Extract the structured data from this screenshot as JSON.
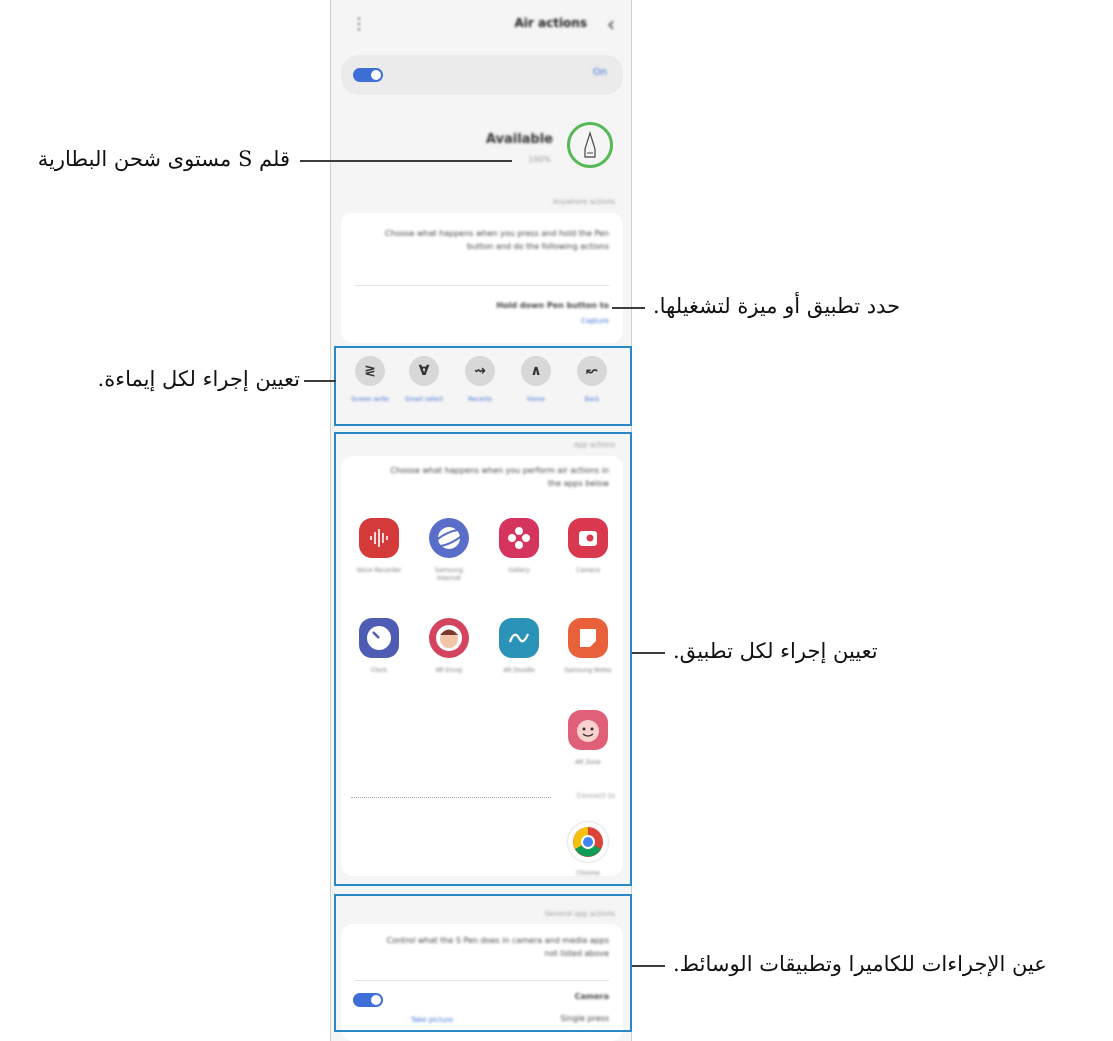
{
  "phone": {
    "title": "Air actions",
    "back_icon": "‹",
    "menu_icon": "⋮",
    "on_label": "On",
    "status_title": "Available",
    "battery_text": "100%",
    "anywhere_header": "Anywhere actions",
    "anywhere_desc": "Choose what happens when you press and hold the Pen button and do the following actions",
    "hold_title": "Hold down Pen button to",
    "hold_value": "Capture",
    "gestures": [
      {
        "glyph": "↜",
        "label": "Back"
      },
      {
        "glyph": "∧",
        "label": "Home"
      },
      {
        "glyph": "⇝",
        "label": "Recents"
      },
      {
        "glyph": "∀",
        "label": "Smart select"
      },
      {
        "glyph": "≷",
        "label": "Screen write"
      }
    ],
    "app_header": "App actions",
    "app_desc": "Choose what happens when you perform air actions in the apps below",
    "apps": [
      {
        "label": "Camera",
        "color": "#d9384e",
        "icon": "camera-app-icon"
      },
      {
        "label": "Gallery",
        "color": "#d4345e",
        "icon": "gallery-app-icon"
      },
      {
        "label": "Samsung Internet",
        "color": "#5a6dc8",
        "icon": "internet-app-icon"
      },
      {
        "label": "Voice Recorder",
        "color": "#d43a3a",
        "icon": "voice-recorder-app-icon"
      },
      {
        "label": "Samsung Notes",
        "color": "#e8613a",
        "icon": "notes-app-icon"
      },
      {
        "label": "AR Doodle",
        "color": "#2c93b8",
        "icon": "ar-doodle-app-icon"
      },
      {
        "label": "AR Emoji",
        "color": "#d4445e",
        "icon": "ar-emoji-app-icon"
      },
      {
        "label": "Clock",
        "color": "#4e5cb4",
        "icon": "clock-app-icon"
      },
      {
        "label": "AR Zone",
        "color": "#e0607a",
        "icon": "ar-zone-app-icon"
      }
    ],
    "connected_header": "Connect to",
    "chrome_label": "Chrome",
    "general_header": "General app actions",
    "general_desc": "Control what the S Pen does in camera and media apps not listed above",
    "camera_title": "Camera",
    "camera_value": "Single press",
    "camera_link": "Take picture"
  },
  "annotations": {
    "battery": "قلم S مستوى شحن البطارية",
    "feature": "حدد تطبيق أو ميزة لتشغيلها.",
    "gesture": "تعيين إجراء لكل إيماءة.",
    "app": "تعيين إجراء لكل تطبيق.",
    "media": "عين الإجراءات للكاميرا وتطبيقات الوسائط."
  },
  "colors": {
    "annotation_box": "#2a88c7",
    "toggle_on": "#3e6fd6",
    "pen_ring": "#57b857"
  }
}
